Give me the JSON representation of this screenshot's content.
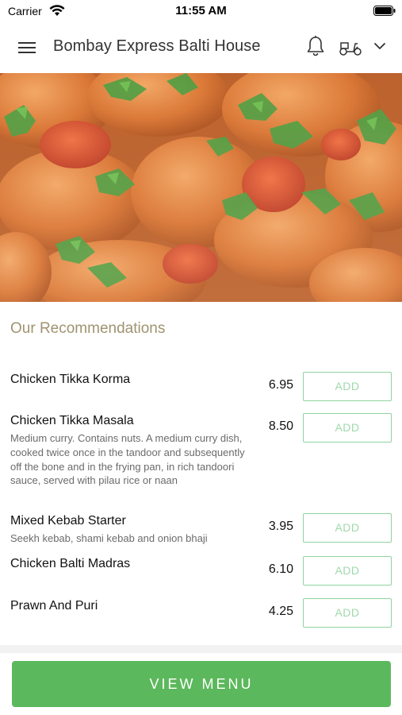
{
  "status_bar": {
    "carrier": "Carrier",
    "time": "11:55 AM"
  },
  "header": {
    "title": "Bombay Express Balti House",
    "icons": [
      "menu-icon",
      "bell-icon",
      "scooter-icon",
      "chevron-down-icon"
    ]
  },
  "hero": {
    "image": "curry-dish-photo"
  },
  "recommendations": {
    "title": "Our Recommendations",
    "items": [
      {
        "name": "Chicken Tikka Korma",
        "description": "",
        "price": "6.95",
        "add_label": "ADD"
      },
      {
        "name": "Chicken Tikka Masala",
        "description": "Medium curry. Contains nuts. A medium curry dish, cooked twice once in the tandoor and subsequently off the bone and in the frying pan, in rich tandoori sauce, served with pilau rice or naan",
        "price": "8.50",
        "add_label": "ADD"
      },
      {
        "name": "Mixed Kebab Starter",
        "description": "Seekh kebab, shami kebab and onion bhaji",
        "price": "3.95",
        "add_label": "ADD"
      },
      {
        "name": "Chicken Balti Madras",
        "description": "",
        "price": "6.10",
        "add_label": "ADD"
      },
      {
        "name": "Prawn And Puri",
        "description": "",
        "price": "4.25",
        "add_label": "ADD"
      }
    ]
  },
  "footer": {
    "view_menu_label": "VIEW MENU"
  },
  "colors": {
    "accent_green": "#5cb85c",
    "add_border": "#8fd39d",
    "section_title": "#a09370"
  }
}
